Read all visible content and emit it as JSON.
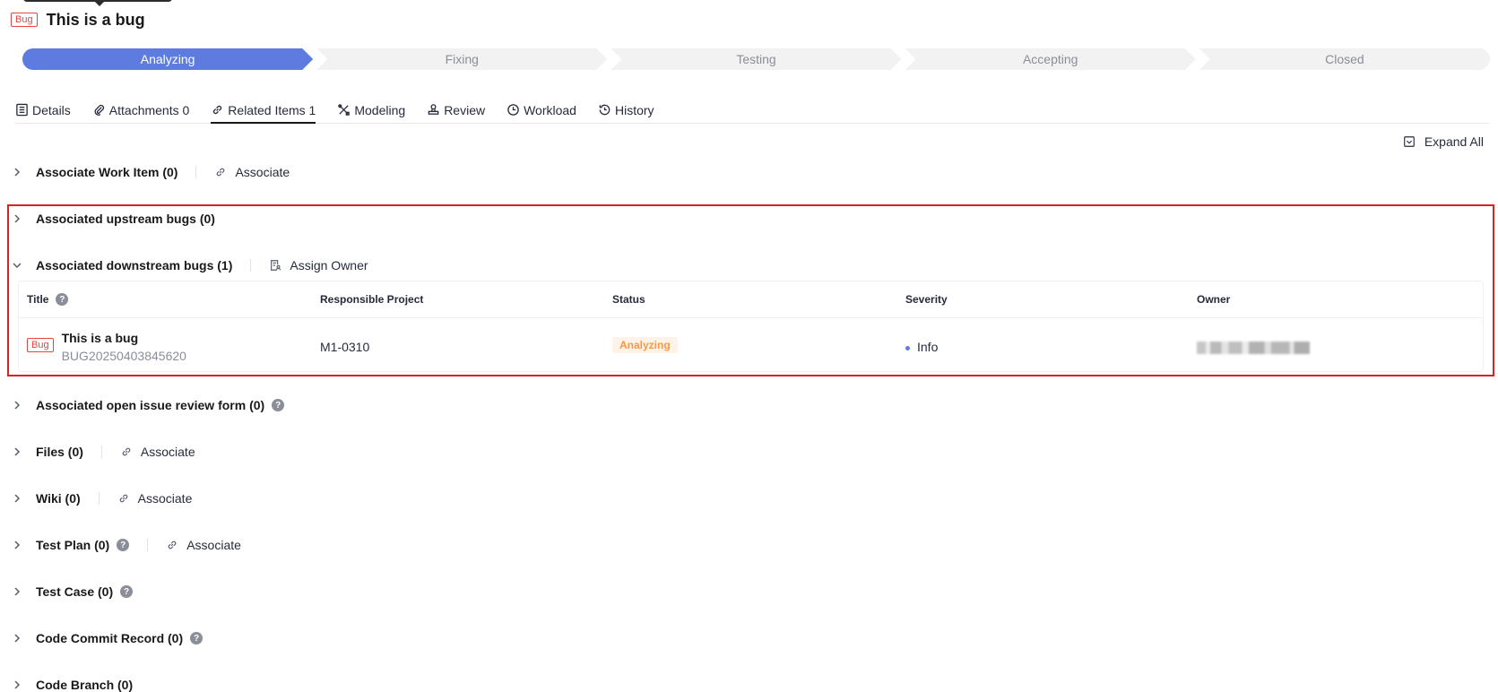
{
  "header": {
    "tag": "Bug",
    "title": "This is a bug"
  },
  "stepper": [
    {
      "label": "Analyzing",
      "active": true
    },
    {
      "label": "Fixing",
      "active": false
    },
    {
      "label": "Testing",
      "active": false
    },
    {
      "label": "Accepting",
      "active": false
    },
    {
      "label": "Closed",
      "active": false
    }
  ],
  "tabs": [
    {
      "label": "Details",
      "icon": "document-list-icon"
    },
    {
      "label": "Attachments 0",
      "icon": "paperclip-icon"
    },
    {
      "label": "Related Items 1",
      "icon": "link-icon",
      "active": true
    },
    {
      "label": "Modeling",
      "icon": "modeling-icon"
    },
    {
      "label": "Review",
      "icon": "stamp-icon"
    },
    {
      "label": "Workload",
      "icon": "clock-icon"
    },
    {
      "label": "History",
      "icon": "history-icon"
    }
  ],
  "expand_all": "Expand All",
  "sections": {
    "work_item": {
      "title": "Associate Work Item (0)",
      "action": "Associate"
    },
    "upstream": {
      "title": "Associated upstream bugs (0)"
    },
    "downstream": {
      "title": "Associated downstream bugs (1)",
      "action": "Assign Owner"
    },
    "review_form": {
      "title": "Associated open issue review form (0)"
    },
    "files": {
      "title": "Files (0)",
      "action": "Associate"
    },
    "wiki": {
      "title": "Wiki (0)",
      "action": "Associate"
    },
    "test_plan": {
      "title": "Test Plan (0)",
      "action": "Associate"
    },
    "test_case": {
      "title": "Test Case (0)"
    },
    "commit": {
      "title": "Code Commit Record (0)"
    },
    "branch": {
      "title": "Code Branch (0)"
    }
  },
  "help_glyph": "?",
  "table": {
    "columns": [
      "Title",
      "Responsible Project",
      "Status",
      "Severity",
      "Owner"
    ],
    "rows": [
      {
        "tag": "Bug",
        "title": "This is a bug",
        "id": "BUG20250403845620",
        "project": "M1-0310",
        "status": "Analyzing",
        "severity": "Info",
        "owner": "blurred-name"
      }
    ]
  },
  "colors": {
    "accent": "#5e7ce0",
    "bug_tag": "#e54545",
    "status_analyzing": "#fa9841",
    "highlight_border": "#e02020"
  }
}
